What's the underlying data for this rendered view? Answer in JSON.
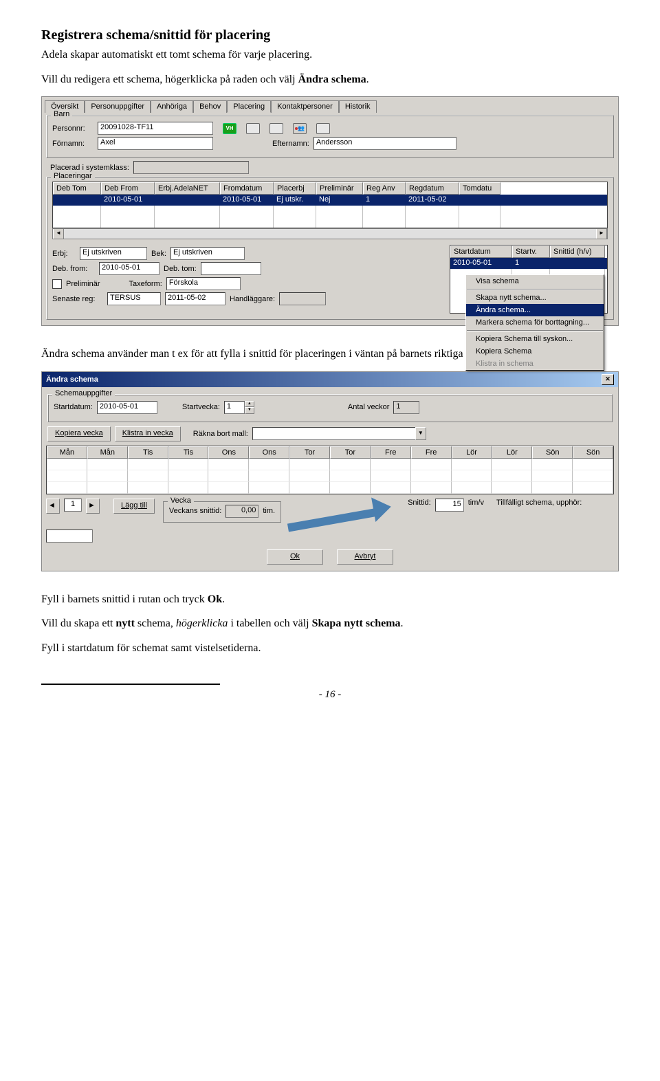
{
  "doc": {
    "title": "Registrera schema/snittid för placering",
    "intro1": "Adela skapar automatiskt ett tomt schema för varje placering.",
    "intro2a": "Vill du redigera ett schema, högerklicka på raden och välj ",
    "intro2b": "Ändra schema",
    "intro2c": ".",
    "mid1": "Ändra schema använder man t ex för att fylla i snittid för placeringen i väntan på barnets riktiga tider.",
    "fill1a": "Fyll i barnets snittid i rutan och tryck ",
    "fill1b": "Ok",
    "fill1c": ".",
    "new1a": "Vill du skapa ett ",
    "new1b": "nytt",
    "new1c": " schema, ",
    "new1d": "högerklicka",
    "new1e": " i tabellen och välj ",
    "new1f": "Skapa nytt schema",
    "new1g": ".",
    "last": "Fyll i startdatum för schemat samt vistelsetiderna.",
    "page": "- 16 -"
  },
  "tabs": [
    "Översikt",
    "Personuppgifter",
    "Anhöriga",
    "Behov",
    "Placering",
    "Kontaktpersoner",
    "Historik"
  ],
  "barn": {
    "group": "Barn",
    "personnr_lbl": "Personnr:",
    "personnr": "20091028-TF11",
    "fornamn_lbl": "Förnamn:",
    "fornamn": "Axel",
    "efternamn_lbl": "Efternamn:",
    "efternamn": "Andersson",
    "vh": "VH"
  },
  "klass_lbl": "Placerad i systemklass:",
  "plac": {
    "group": "Placeringar",
    "cols": [
      "Deb Tom",
      "Deb From",
      "Erbj.AdelaNET",
      "Fromdatum",
      "Placerbj",
      "Preliminär",
      "Reg Anv",
      "Regdatum",
      "Tomdatu"
    ],
    "row": [
      "",
      "2010-05-01",
      "",
      "2010-05-01",
      "Ej utskr.",
      "Nej",
      "1",
      "2011-05-02",
      ""
    ]
  },
  "lower": {
    "erbj_lbl": "Erbj:",
    "erbj": "Ej utskriven",
    "bek_lbl": "Bek:",
    "bek": "Ej utskriven",
    "debfrom_lbl": "Deb. from:",
    "debfrom": "2010-05-01",
    "debtom_lbl": "Deb. tom:",
    "prelim_lbl": "Preliminär",
    "taxeform_lbl": "Taxeform:",
    "taxeform": "Förskola",
    "senaste_lbl": "Senaste reg:",
    "senaste_user": "TERSUS",
    "senaste_date": "2011-05-02",
    "handlaggare_lbl": "Handläggare:"
  },
  "schedgrid": {
    "cols": [
      "Startdatum",
      "Startv.",
      "Snittid (h/v)"
    ],
    "row": [
      "2010-05-01",
      "1",
      ""
    ]
  },
  "menu": {
    "visa": "Visa schema",
    "skapa": "Skapa nytt schema...",
    "andra": "Ändra schema...",
    "markera": "Markera schema för borttagning...",
    "kop_sysk": "Kopiera Schema till syskon...",
    "kop": "Kopiera Schema",
    "klistra": "Klistra in schema"
  },
  "dlg": {
    "title": "Ändra schema",
    "group": "Schemauppgifter",
    "startdatum_lbl": "Startdatum:",
    "startdatum": "2010-05-01",
    "startvecka_lbl": "Startvecka:",
    "startvecka": "1",
    "antal_lbl": "Antal veckor",
    "antal": "1",
    "kop_btn": "Kopiera vecka",
    "klistra_btn": "Klistra in vecka",
    "rakna_lbl": "Räkna bort mall:",
    "days": [
      "Mån",
      "Mån",
      "Tis",
      "Tis",
      "Ons",
      "Ons",
      "Tor",
      "Tor",
      "Fre",
      "Fre",
      "Lör",
      "Lör",
      "Sön",
      "Sön"
    ],
    "pager": "1",
    "lagg_btn": "Lägg till",
    "vecka_group": "Vecka",
    "veckans_lbl": "Veckans snittid:",
    "veckans_val": "0,00",
    "tim_lbl": "tim.",
    "snittid_lbl": "Snittid:",
    "snittid_val": "15",
    "timv_lbl": "tim/v",
    "tillf_lbl": "Tillfälligt schema, upphör:",
    "ok": "Ok",
    "avbryt": "Avbryt"
  }
}
